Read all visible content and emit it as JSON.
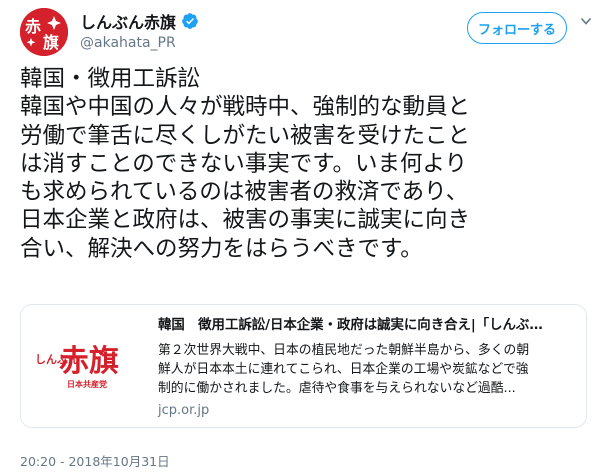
{
  "author": {
    "display_name": "しんぶん赤旗",
    "handle": "@akahata_PR",
    "avatar_text": "赤旗",
    "verified": true
  },
  "actions": {
    "follow_label": "フォローする"
  },
  "tweet": {
    "lines": [
      "韓国・徴用工訴訟",
      "韓国や中国の人々が戦時中、強制的な動員と",
      "労働で筆舌に尽くしがたい被害を受けたこと",
      "は消すことのできない事実です。いま何より",
      "も求められているのは被害者の救済であり、",
      "日本企業と政府は、被害の事実に誠実に向き",
      "合い、解決への努力をはらうべきです。"
    ],
    "timestamp": "20:20 - 2018年10月31日"
  },
  "card": {
    "thumb_small": "しんぶん",
    "thumb_big": "赤旗",
    "thumb_sub": "日本共産党",
    "title": "韓国　徴用工訴訟/日本企業・政府は誠実に向き合え|「しんぶ…",
    "desc_lines": [
      "第２次世界大戦中、日本の植民地だった朝鮮半島から、多くの朝",
      "鮮人が日本本土に連れてこられ、日本企業の工場や炭鉱などで強",
      "制的に働かされました。虐待や食事を与えられないなど過酷..."
    ],
    "domain": "jcp.or.jp"
  },
  "colors": {
    "brand_red": "#d4212b",
    "twitter_blue": "#1da1f2",
    "muted_gray": "#657786"
  },
  "icons": {
    "verified": "verified-badge-icon",
    "caret": "chevron-down-icon"
  }
}
